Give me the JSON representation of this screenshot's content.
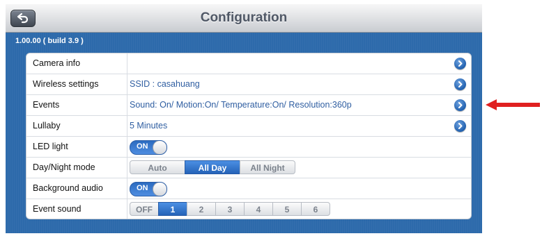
{
  "header": {
    "title": "Configuration",
    "back_icon": "back-arrow-icon"
  },
  "version": "1.00.00 ( build 3.9 )",
  "rows": [
    {
      "label": "Camera info",
      "value": ""
    },
    {
      "label": "Wireless settings",
      "value": "SSID : casahuang"
    },
    {
      "label": "Events",
      "value": "Sound: On/ Motion:On/ Temperature:On/ Resolution:360p"
    },
    {
      "label": "Lullaby",
      "value": "5 Minutes"
    },
    {
      "label": "LED light",
      "toggle": "ON"
    },
    {
      "label": "Day/Night mode",
      "options": [
        "Auto",
        "All Day",
        "All Night"
      ],
      "selected": "All Day"
    },
    {
      "label": "Background audio",
      "toggle": "ON"
    },
    {
      "label": "Event sound",
      "options": [
        "OFF",
        "1",
        "2",
        "3",
        "4",
        "5",
        "6"
      ],
      "selected": "1"
    }
  ],
  "colors": {
    "accent": "#2d6aab",
    "annotation_arrow": "#e02020"
  }
}
